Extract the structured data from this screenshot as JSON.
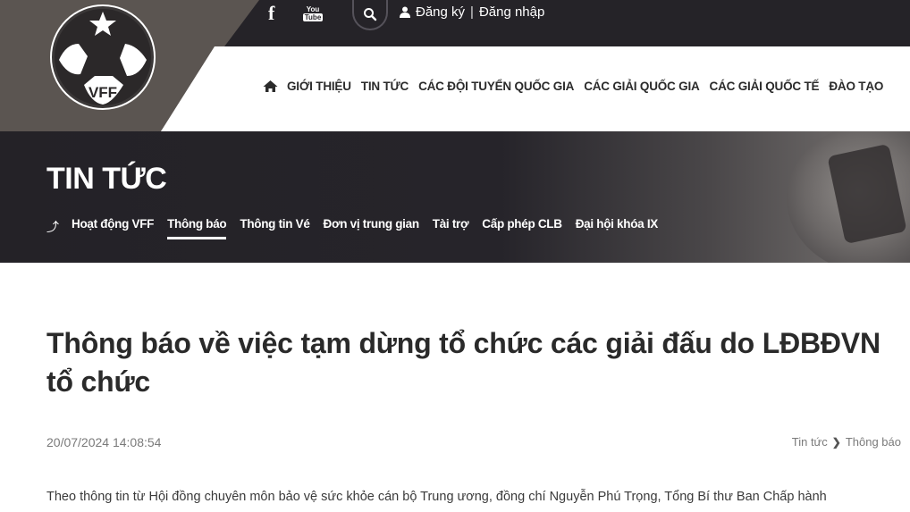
{
  "header": {
    "logo_text": "VFF",
    "auth": {
      "register": "Đăng ký",
      "separator": "|",
      "login": "Đăng nhập"
    },
    "social": {
      "facebook": "f",
      "youtube_top": "You",
      "youtube_bottom": "Tube"
    },
    "nav": [
      {
        "label": "GIỚI THIỆU"
      },
      {
        "label": "TIN TỨC"
      },
      {
        "label": "CÁC ĐỘI TUYỂN QUỐC GIA"
      },
      {
        "label": "CÁC GIẢI QUỐC GIA"
      },
      {
        "label": "CÁC GIẢI QUỐC TẾ"
      },
      {
        "label": "ĐÀO TẠO"
      }
    ]
  },
  "hero": {
    "title": "TIN TỨC",
    "subnav": [
      {
        "label": "Hoạt động VFF"
      },
      {
        "label": "Thông báo",
        "active": true
      },
      {
        "label": "Thông tin Vé"
      },
      {
        "label": "Đơn vị trung gian"
      },
      {
        "label": "Tài trợ"
      },
      {
        "label": "Cấp phép CLB"
      },
      {
        "label": "Đại hội khóa IX"
      }
    ]
  },
  "article": {
    "title": "Thông báo về việc tạm dừng tổ chức các giải đấu do LĐBĐVN tổ chức",
    "datetime": "20/07/2024 14:08:54",
    "breadcrumb": [
      "Tin tức",
      "Thông báo"
    ],
    "body_first_line": "Theo thông tin từ Hội đồng chuyên môn bảo vệ sức khỏe cán bộ Trung ương, đồng chí Nguyễn Phú Trọng, Tổng Bí thư Ban Chấp hành"
  },
  "colors": {
    "topbar": "#252328",
    "logo_band": "#5b5551",
    "hero": "#242227",
    "text": "#2a2a2a"
  },
  "icons": {
    "facebook": "facebook-icon",
    "youtube": "youtube-icon",
    "search": "search-icon",
    "user": "user-icon",
    "home": "home-icon",
    "up": "level-up-icon",
    "chevron": "chevron-right-icon"
  }
}
